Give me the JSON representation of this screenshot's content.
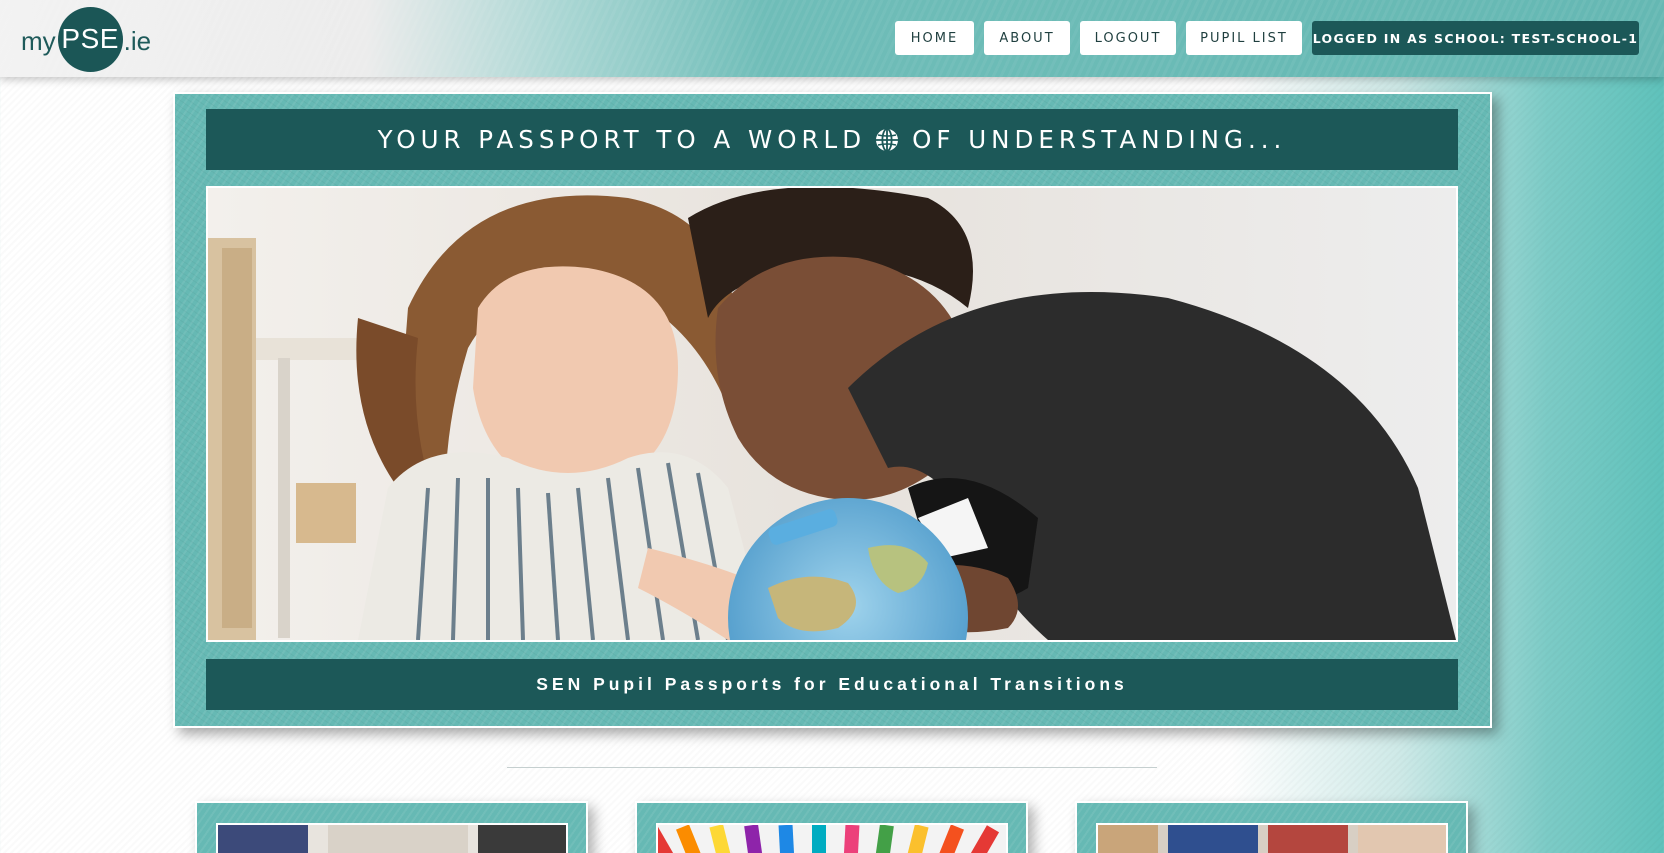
{
  "logo": {
    "prefix": "my",
    "main": "PSE",
    "suffix": ".ie"
  },
  "nav": {
    "items": [
      {
        "label": "HOME"
      },
      {
        "label": "ABOUT"
      },
      {
        "label": "LOGOUT"
      },
      {
        "label": "PUPIL LIST"
      }
    ],
    "logged_in_label": "LOGGED IN AS SCHOOL: TEST-SCHOOL-1"
  },
  "hero": {
    "title_part1": "YOUR PASSPORT TO A WORLD",
    "title_icon": "globe-icon",
    "title_part2": "OF UNDERSTANDING...",
    "image_subject": "girl-and-teacher-looking-at-globe",
    "subtitle": "SEN Pupil Passports for Educational Transitions"
  },
  "cards": [
    {
      "image_subject": "pupils-classroom"
    },
    {
      "image_subject": "colored-pencils"
    },
    {
      "image_subject": "children-in-classroom"
    }
  ],
  "colors": {
    "brand_dark": "#1c5858",
    "brand_teal": "#66b9b4",
    "nav_button_bg": "#ffffff"
  }
}
